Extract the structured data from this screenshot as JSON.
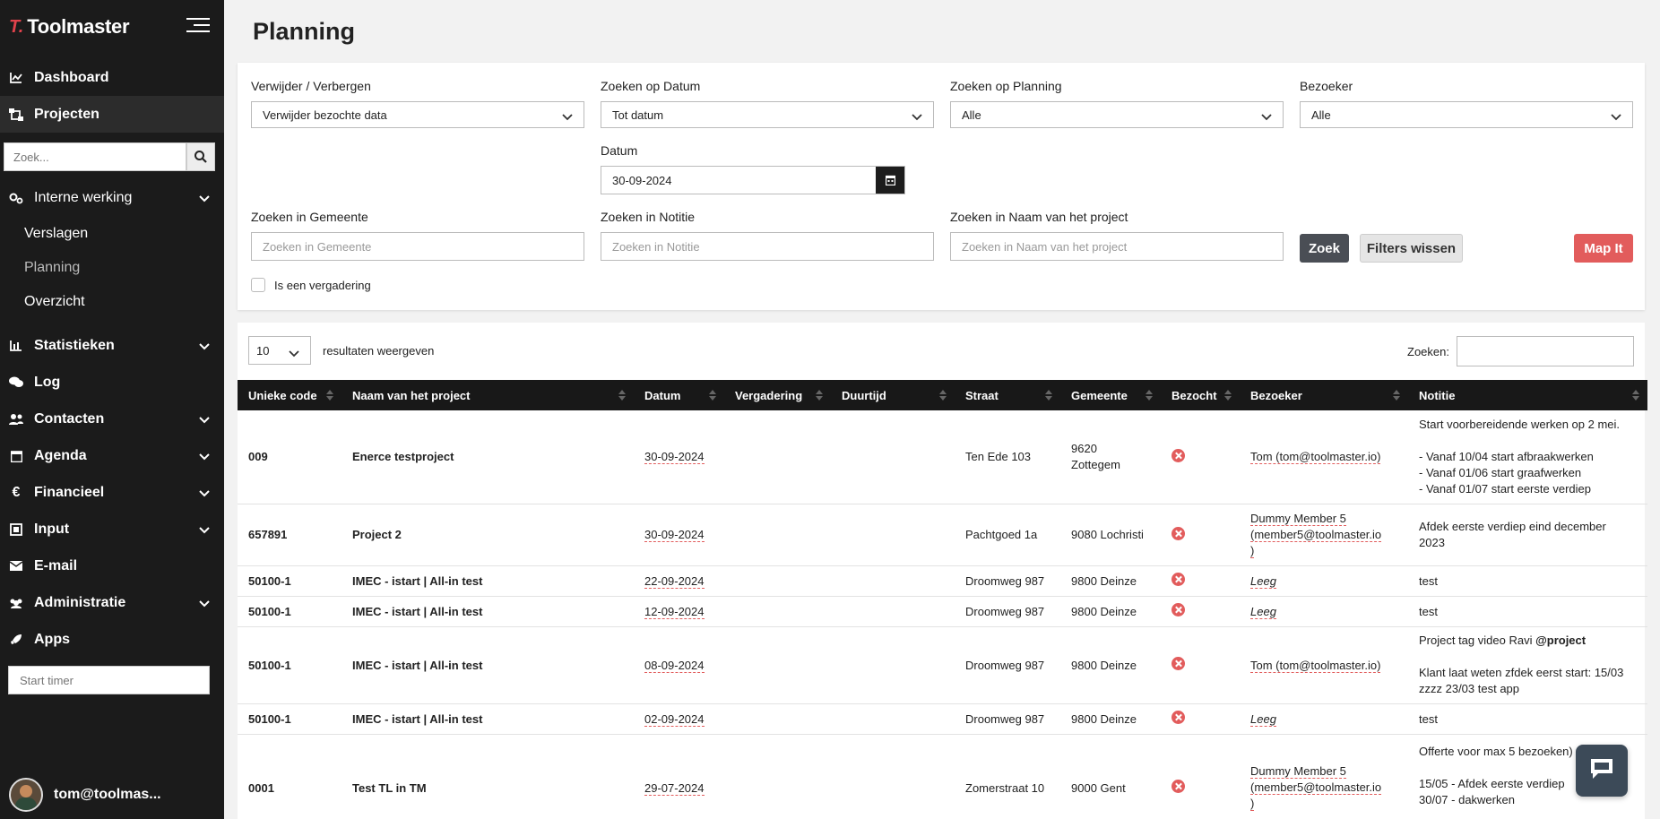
{
  "app": {
    "logo_mark": "T.",
    "logo_text": "Toolmaster"
  },
  "sidebar": {
    "dashboard": "Dashboard",
    "projecten": "Projecten",
    "search_placeholder": "Zoek...",
    "interne": "Interne werking",
    "verslagen": "Verslagen",
    "planning": "Planning",
    "overzicht": "Overzicht",
    "statistieken": "Statistieken",
    "log": "Log",
    "contacten": "Contacten",
    "agenda": "Agenda",
    "financieel": "Financieel",
    "input": "Input",
    "email": "E-mail",
    "administratie": "Administratie",
    "apps": "Apps",
    "timer_placeholder": "Start timer",
    "user": "tom@toolmas..."
  },
  "page": {
    "title": "Planning"
  },
  "filters": {
    "verwijder_label": "Verwijder / Verbergen",
    "verwijder_value": "Verwijder bezochte data",
    "datum_label": "Zoeken op Datum",
    "datum_value": "Tot datum",
    "planning_label": "Zoeken op Planning",
    "planning_value": "Alle",
    "bezoeker_label": "Bezoeker",
    "bezoeker_value": "Alle",
    "date_label": "Datum",
    "date_value": "30-09-2024",
    "gemeente_label": "Zoeken in Gemeente",
    "gemeente_placeholder": "Zoeken in Gemeente",
    "notitie_label": "Zoeken in Notitie",
    "notitie_placeholder": "Zoeken in Notitie",
    "naam_label": "Zoeken in Naam van het project",
    "naam_placeholder": "Zoeken in Naam van het project",
    "zoek_btn": "Zoek",
    "wissen_btn": "Filters wissen",
    "map_btn": "Map It",
    "vergadering_check": "Is een vergadering"
  },
  "table_controls": {
    "length_value": "10",
    "length_text": "resultaten weergeven",
    "search_label": "Zoeken:"
  },
  "table": {
    "headers": [
      "Unieke code",
      "Naam van het project",
      "Datum",
      "Vergadering",
      "Duurtijd",
      "Straat",
      "Gemeente",
      "Bezocht",
      "Bezoeker",
      "Notitie"
    ],
    "rows": [
      {
        "code": "009",
        "naam": "Enerce testproject",
        "datum": "30-09-2024",
        "straat": "Ten Ede 103",
        "gemeente_1": "9620",
        "gemeente_2": "Zottegem",
        "bezoeker_1": "Tom (tom@toolmaster.io)",
        "bezoeker_2": "",
        "bezoeker_3": "",
        "leeg": "",
        "n1": "Start voorbereidende werken op 2 mei.",
        "n2": "",
        "n3": "- Vanaf 10/04 start afbraakwerken",
        "n4": "- Vanaf 01/06 start graafwerken",
        "n5": "- Vanaf 01/07 start eerste verdiep"
      },
      {
        "code": "657891",
        "naam": "Project 2",
        "datum": "30-09-2024",
        "straat": "Pachtgoed 1a",
        "gemeente_1": "9080 Lochristi",
        "gemeente_2": "",
        "bezoeker_1": "Dummy Member 5",
        "bezoeker_2": "(member5@toolmaster.io",
        "bezoeker_3": ")",
        "leeg": "",
        "n1": "Afdek eerste verdiep eind december",
        "n2": "2023",
        "n3": "",
        "n4": "",
        "n5": ""
      },
      {
        "code": "50100-1",
        "naam": "IMEC - istart | All-in test",
        "datum": "22-09-2024",
        "straat": "Droomweg 987",
        "gemeente_1": "9800 Deinze",
        "gemeente_2": "",
        "bezoeker_1": "",
        "bezoeker_2": "",
        "bezoeker_3": "",
        "leeg": "Leeg",
        "n1": "test",
        "n2": "",
        "n3": "",
        "n4": "",
        "n5": ""
      },
      {
        "code": "50100-1",
        "naam": "IMEC - istart | All-in test",
        "datum": "12-09-2024",
        "straat": "Droomweg 987",
        "gemeente_1": "9800 Deinze",
        "gemeente_2": "",
        "bezoeker_1": "",
        "bezoeker_2": "",
        "bezoeker_3": "",
        "leeg": "Leeg",
        "n1": "test",
        "n2": "",
        "n3": "",
        "n4": "",
        "n5": ""
      },
      {
        "code": "50100-1",
        "naam": "IMEC - istart | All-in test",
        "datum": "08-09-2024",
        "straat": "Droomweg 987",
        "gemeente_1": "9800 Deinze",
        "gemeente_2": "",
        "bezoeker_1": "Tom (tom@toolmaster.io)",
        "bezoeker_2": "",
        "bezoeker_3": "",
        "leeg": "",
        "n1": "Project tag video Ravi",
        "n1b": "@project",
        "n2": "",
        "n3": "Klant laat weten zfdek eerst start: 15/03",
        "n4": "zzzz 23/03 test app",
        "n5": ""
      },
      {
        "code": "50100-1",
        "naam": "IMEC - istart | All-in test",
        "datum": "02-09-2024",
        "straat": "Droomweg 987",
        "gemeente_1": "9800 Deinze",
        "gemeente_2": "",
        "bezoeker_1": "",
        "bezoeker_2": "",
        "bezoeker_3": "",
        "leeg": "Leeg",
        "n1": "test",
        "n2": "",
        "n3": "",
        "n4": "",
        "n5": ""
      },
      {
        "code": "0001",
        "naam": "Test TL in TM",
        "datum": "29-07-2024",
        "straat": "Zomerstraat 10",
        "gemeente_1": "9000 Gent",
        "gemeente_2": "",
        "bezoeker_1": "Dummy Member 5",
        "bezoeker_2": "(member5@toolmaster.io",
        "bezoeker_3": ")",
        "leeg": "",
        "n1": "Offerte voor max 5 bezoeken)",
        "n2": "",
        "n3": "15/05 - Afdek eerste verdiep",
        "n4": "30/07 - dakwerken",
        "n5": ""
      }
    ]
  },
  "colors": {
    "sidebar": "#1b1b1b",
    "accent_red": "#e25c5c",
    "header": "#181818",
    "chat": "#3c4a58"
  }
}
